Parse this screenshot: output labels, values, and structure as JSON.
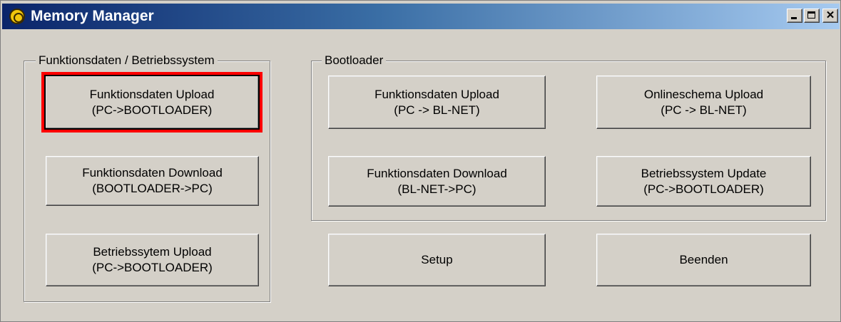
{
  "window": {
    "title": "Memory Manager"
  },
  "groups": {
    "left_label": "Funktionsdaten / Betriebssystem",
    "right_label": "Bootloader"
  },
  "buttons": {
    "funk_upload_bootloader": {
      "line1": "Funktionsdaten Upload",
      "line2": "(PC->BOOTLOADER)"
    },
    "funk_download_bootloader": {
      "line1": "Funktionsdaten Download",
      "line2": "(BOOTLOADER->PC)"
    },
    "os_upload_bootloader": {
      "line1": "Betriebssytem Upload",
      "line2": "(PC->BOOTLOADER)"
    },
    "funk_upload_blnet": {
      "line1": "Funktionsdaten Upload",
      "line2": "(PC -> BL-NET)"
    },
    "funk_download_blnet": {
      "line1": "Funktionsdaten Download",
      "line2": "(BL-NET->PC)"
    },
    "onlineschema_upload": {
      "line1": "Onlineschema Upload",
      "line2": "(PC -> BL-NET)"
    },
    "os_update": {
      "line1": "Betriebssystem Update",
      "line2": "(PC->BOOTLOADER)"
    },
    "setup": {
      "label": "Setup"
    },
    "beenden": {
      "label": "Beenden"
    }
  },
  "highlight_color": "#ff0000",
  "titlebar_colors": [
    "#0a246a",
    "#a6caf0"
  ]
}
